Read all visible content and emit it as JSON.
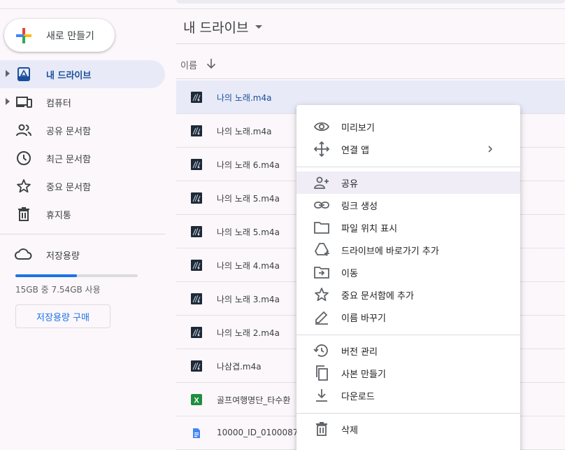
{
  "sidebar": {
    "new_label": "새로 만들기",
    "items": [
      {
        "label": "내 드라이브",
        "icon": "drive-icon",
        "active": true
      },
      {
        "label": "컴퓨터",
        "icon": "computer-icon"
      },
      {
        "label": "공유 문서함",
        "icon": "people-icon"
      },
      {
        "label": "최근 문서함",
        "icon": "clock-icon"
      },
      {
        "label": "중요 문서함",
        "icon": "star-icon"
      },
      {
        "label": "휴지통",
        "icon": "trash-icon"
      }
    ],
    "storage": {
      "label": "저장용량",
      "usage_text": "15GB 중 7.54GB 사용",
      "used_fraction": 0.5,
      "buy_label": "저장용량 구매"
    }
  },
  "main": {
    "title": "내 드라이브",
    "column_name": "이름",
    "files": [
      {
        "name": "나의 노래.m4a",
        "type": "audio",
        "selected": true
      },
      {
        "name": "나의 노래.m4a",
        "type": "audio"
      },
      {
        "name": "나의 노래 6.m4a",
        "type": "audio"
      },
      {
        "name": "나의 노래 5.m4a",
        "type": "audio"
      },
      {
        "name": "나의 노래 5.m4a",
        "type": "audio"
      },
      {
        "name": "나의 노래 4.m4a",
        "type": "audio"
      },
      {
        "name": "나의 노래 3.m4a",
        "type": "audio"
      },
      {
        "name": "나의 노래 2.m4a",
        "type": "audio"
      },
      {
        "name": "나삼겹.m4a",
        "type": "audio"
      },
      {
        "name": "골프여행명단_타수환",
        "type": "sheet"
      },
      {
        "name": "10000_ID_0100087",
        "type": "doc"
      }
    ]
  },
  "context_menu": {
    "items": [
      {
        "label": "미리보기",
        "icon": "eye-icon"
      },
      {
        "label": "연결 앱",
        "icon": "move-arrows-icon",
        "submenu": true
      },
      {
        "label": "공유",
        "icon": "person-add-icon",
        "hover": true
      },
      {
        "label": "링크 생성",
        "icon": "link-icon"
      },
      {
        "label": "파일 위치 표시",
        "icon": "folder-icon"
      },
      {
        "label": "드라이브에 바로가기 추가",
        "icon": "drive-shortcut-icon"
      },
      {
        "label": "이동",
        "icon": "folder-move-icon"
      },
      {
        "label": "중요 문서함에 추가",
        "icon": "star-outline-icon"
      },
      {
        "label": "이름 바꾸기",
        "icon": "pencil-icon"
      },
      {
        "label": "버전 관리",
        "icon": "history-icon"
      },
      {
        "label": "사본 만들기",
        "icon": "copy-icon"
      },
      {
        "label": "다운로드",
        "icon": "download-icon"
      },
      {
        "label": "삭제",
        "icon": "trash-icon"
      }
    ]
  },
  "colors": {
    "accent": "#1a73e8",
    "active_bg": "#e8eaf7",
    "sheet_green": "#1e8e3e",
    "doc_blue": "#4285f4"
  }
}
